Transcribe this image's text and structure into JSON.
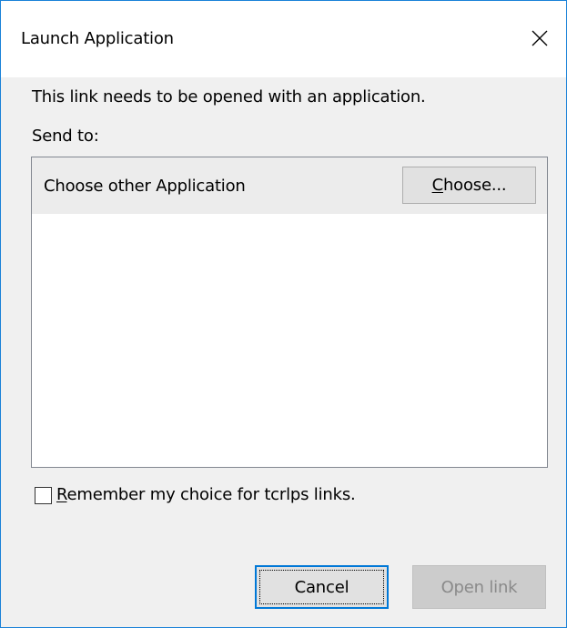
{
  "dialog": {
    "title": "Launch Application",
    "message": "This link needs to be opened with an application.",
    "send_to_label": "Send to:"
  },
  "list": {
    "rows": [
      {
        "label": "Choose other Application",
        "button": {
          "mnemonic": "C",
          "rest": "hoose..."
        }
      }
    ]
  },
  "remember": {
    "mnemonic": "R",
    "rest": "emember my choice for tcrlps links.",
    "checked": false
  },
  "buttons": {
    "cancel": "Cancel",
    "open": "Open link"
  },
  "icons": {
    "close": "close-icon"
  },
  "colors": {
    "accent": "#0078d7",
    "window_border": "#1a82d8",
    "disabled_button": "#cccccc",
    "disabled_text": "#8a8a8a"
  }
}
